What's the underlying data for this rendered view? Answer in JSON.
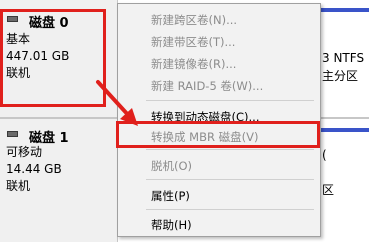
{
  "disks": [
    {
      "title": "磁盘 0",
      "type": "基本",
      "size": "447.01 GB",
      "status": "联机"
    },
    {
      "title": "磁盘 1",
      "type": "可移动",
      "size": "14.44 GB",
      "status": "联机"
    }
  ],
  "volume_fragments": {
    "ntfs": "3 NTFS",
    "primary": "主分区",
    "partial_top": "(",
    "partial_bottom": "区"
  },
  "context_menu": {
    "items": [
      {
        "label": "新建跨区卷(N)...",
        "enabled": false
      },
      {
        "label": "新建带区卷(T)...",
        "enabled": false
      },
      {
        "label": "新建镜像卷(R)...",
        "enabled": false
      },
      {
        "label": "新建 RAID-5 卷(W)...",
        "enabled": false
      },
      {
        "label": "转换到动态磁盘(C)...",
        "enabled": true
      },
      {
        "label": "转换成 MBR 磁盘(V)",
        "enabled": false
      },
      {
        "label": "脱机(O)",
        "enabled": false
      },
      {
        "label": "属性(P)",
        "enabled": true
      },
      {
        "label": "帮助(H)",
        "enabled": true
      }
    ]
  },
  "colors": {
    "annotation_red": "#e0201c",
    "volume_header_blue": "#3a54c9",
    "menu_bg": "#f2f2f2",
    "disabled_text": "#8c8c8c"
  }
}
